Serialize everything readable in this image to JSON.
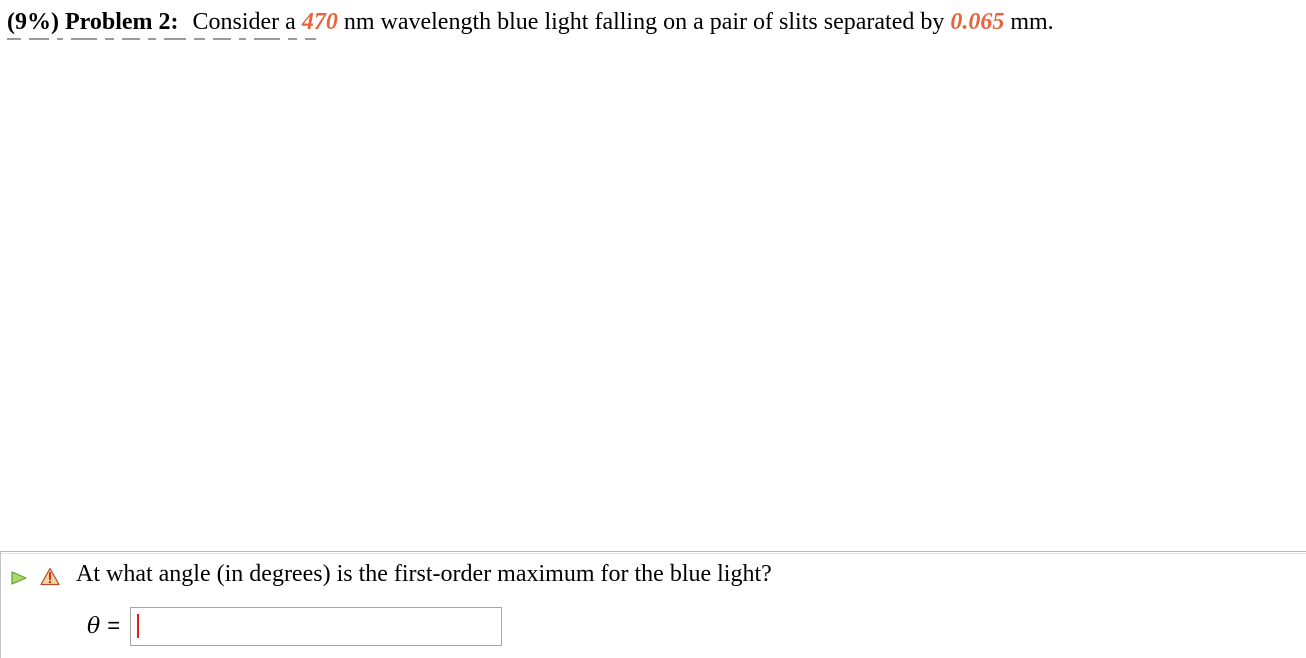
{
  "problem": {
    "weight": "(9%)",
    "label": "Problem 2:",
    "text_before_wavelength": "Consider a",
    "wavelength_value": "470",
    "text_after_wavelength": "nm wavelength blue light falling on a pair of slits separated by",
    "separation_value": "0.065",
    "text_after_separation": "mm."
  },
  "question": {
    "text": "At what angle (in degrees) is the first-order maximum for the blue light?",
    "answer_symbol": "θ",
    "equals": "=",
    "answer_value": "",
    "play_icon": "play-triangle-icon",
    "warning_icon": "warning-triangle-icon"
  },
  "colors": {
    "param_highlight": "#e8643c",
    "play_icon": "#8bc34a",
    "warning_icon": "#d9362b",
    "caret": "#e02020"
  }
}
